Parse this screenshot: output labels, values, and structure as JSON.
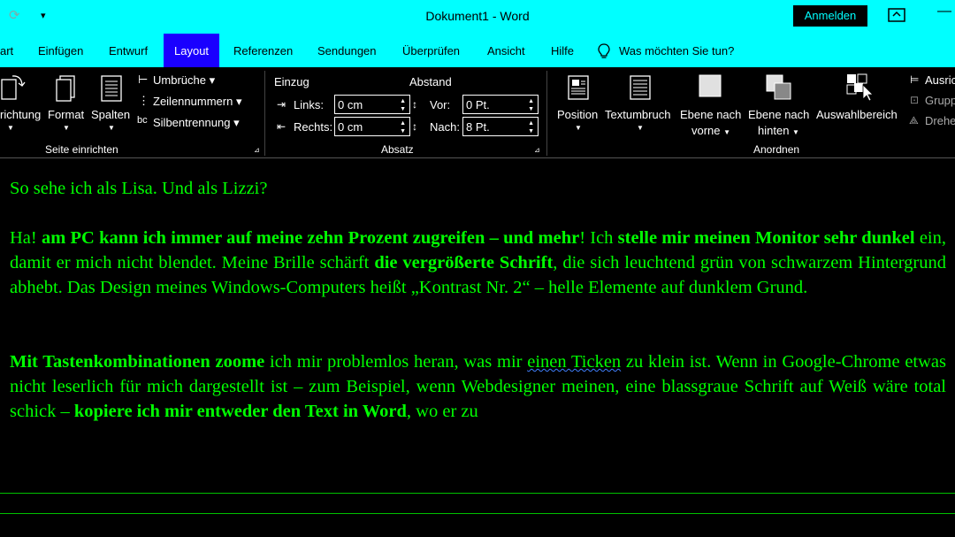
{
  "window": {
    "title": "Dokument1  -  Word",
    "signin_label": "Anmelden",
    "quick_access": {
      "autosave_icon": "sync-icon",
      "customize_icon": "dropdown-icon"
    }
  },
  "tabs": [
    "art",
    "Einfügen",
    "Entwurf",
    "Layout",
    "Referenzen",
    "Sendungen",
    "Überprüfen",
    "Ansicht",
    "Hilfe"
  ],
  "active_tab": "Layout",
  "tell_me": "Was möchten Sie tun?",
  "ribbon": {
    "seite_einrichten": {
      "label": "Seite einrichten",
      "ausrichtung": "richtung",
      "format": "Format",
      "spalten": "Spalten",
      "umbrueche": "Umbrüche",
      "zeilennummern": "Zeilennummern",
      "silbentrennung": "Silbentrennung"
    },
    "absatz": {
      "label": "Absatz",
      "einzug": "Einzug",
      "abstand": "Abstand",
      "links_label": "Links:",
      "links_value": "0 cm",
      "rechts_label": "Rechts:",
      "rechts_value": "0 cm",
      "vor_label": "Vor:",
      "vor_value": "0 Pt.",
      "nach_label": "Nach:",
      "nach_value": "8 Pt."
    },
    "anordnen": {
      "label": "Anordnen",
      "position": "Position",
      "textumbruch": "Textumbruch",
      "ebene_vorne_1": "Ebene nach",
      "ebene_vorne_2": "vorne",
      "ebene_hinten_1": "Ebene nach",
      "ebene_hinten_2": "hinten",
      "auswahlbereich": "Auswahlbereich",
      "ausrichten": "Ausric",
      "gruppieren": "Grupp",
      "drehen": "Drehe"
    }
  },
  "document": {
    "p1": "So sehe ich als Lisa. Und als Lizzi?",
    "p2": [
      {
        "t": "Ha! ",
        "b": false
      },
      {
        "t": "am PC kann ich immer auf meine zehn Prozent zugreifen – und mehr",
        "b": true
      },
      {
        "t": "! Ich ",
        "b": false
      },
      {
        "t": "stelle mir meinen Monitor sehr dunkel",
        "b": true
      },
      {
        "t": " ein, damit er mich nicht blendet. Meine Brille schärft ",
        "b": false
      },
      {
        "t": "die vergrößerte Schrift",
        "b": true
      },
      {
        "t": ", die sich leuchtend grün von schwarzem Hintergrund abhebt. Das Design meines Windows-Computers heißt „Kontrast Nr. 2“ – helle Elemente auf dunklem Grund.",
        "b": false
      }
    ],
    "p3": [
      {
        "t": "Mit Tastenkombinationen zoome",
        "b": true
      },
      {
        "t": " ich mir problemlos heran, was mir ",
        "b": false
      },
      {
        "t": "einen Ticken",
        "b": false,
        "squiggle": true
      },
      {
        "t": " zu klein ist. Wenn in Google-Chrome etwas nicht leserlich für mich dargestellt ist – zum Beispiel, wenn Webdesigner meinen, eine blassgraue Schrift auf Weiß wäre total schick – ",
        "b": false
      },
      {
        "t": "kopiere ich mir entweder den Text in Word",
        "b": true
      },
      {
        "t": ", wo er zu",
        "b": false
      }
    ]
  },
  "colors": {
    "titlebar": "#00ffff",
    "active_tab": "#1a00ff",
    "text": "#00ff00",
    "background": "#000000"
  }
}
